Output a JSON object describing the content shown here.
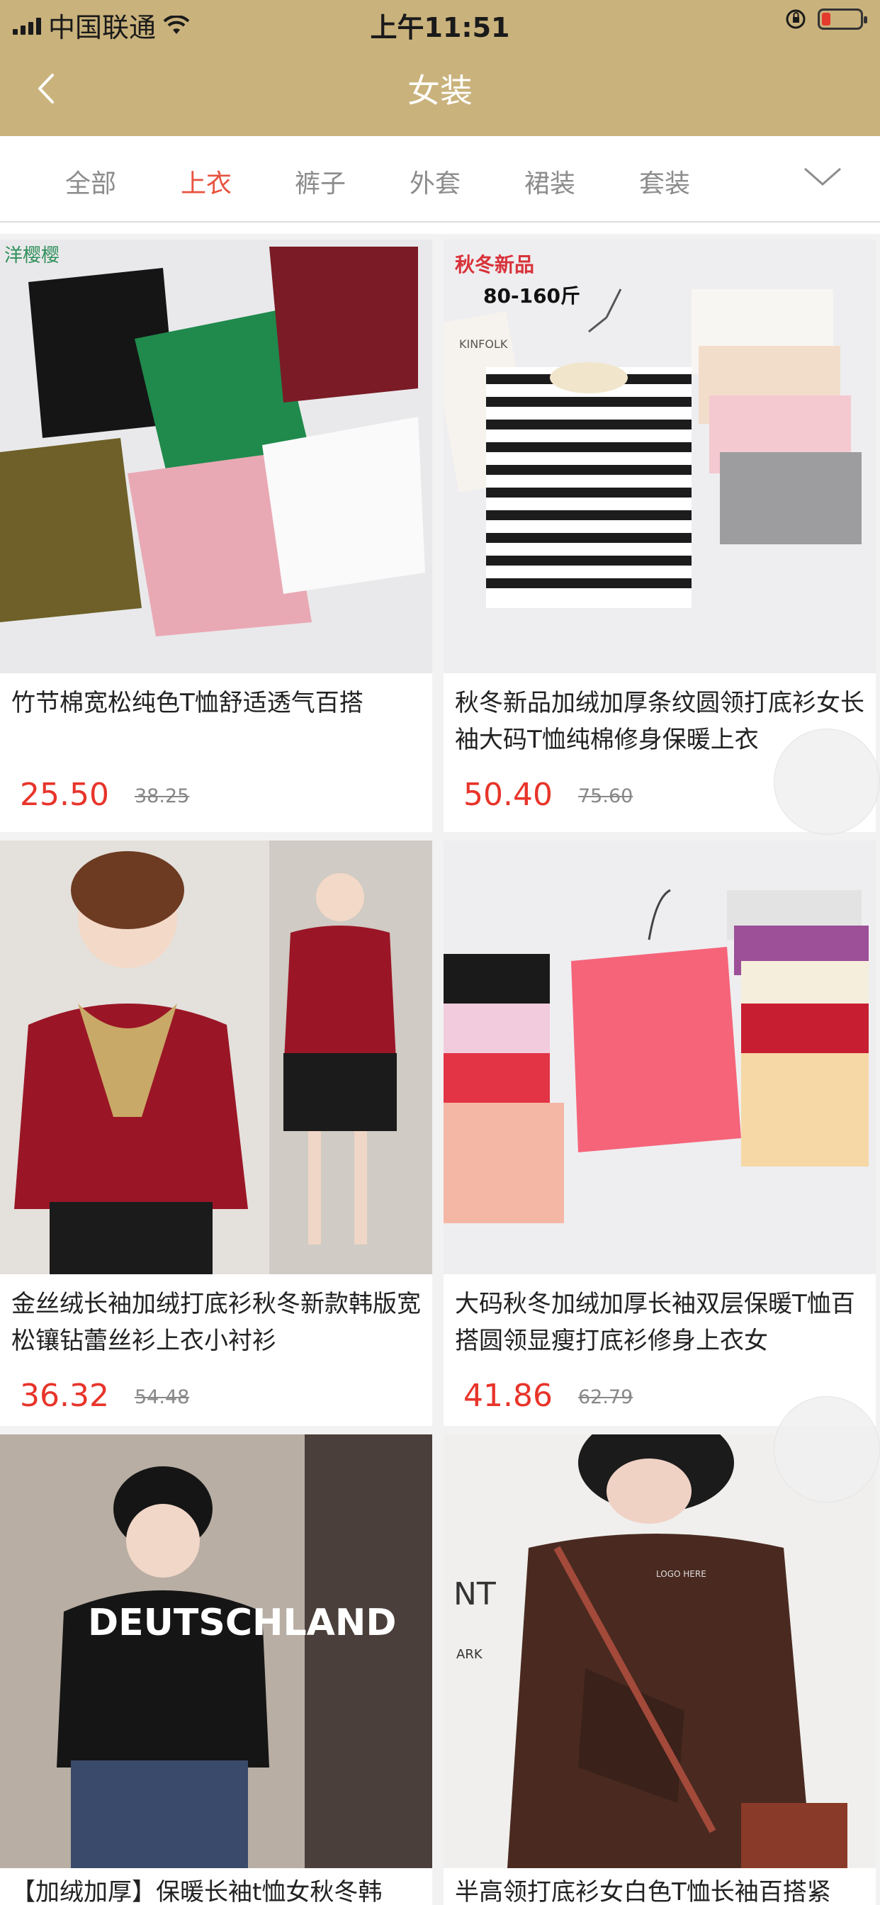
{
  "status": {
    "carrier": "中国联通",
    "time": "上午11:51"
  },
  "header": {
    "title": "女装"
  },
  "tabs": [
    {
      "label": "全部"
    },
    {
      "label": "上衣"
    },
    {
      "label": "裤子"
    },
    {
      "label": "外套"
    },
    {
      "label": "裙装"
    },
    {
      "label": "套装"
    }
  ],
  "colors": {
    "header_bg": "#c9b27c",
    "active_tab": "#e8533f",
    "price": "#e8342a"
  },
  "products": [
    {
      "name": "竹节棉宽松纯色T恤舒适透气百搭",
      "price": "25.50",
      "original_price": "38.25",
      "image_text": [
        "洋樱樱"
      ]
    },
    {
      "name": "秋冬新品加绒加厚条纹圆领打底衫女长袖大码T恤纯棉修身保暖上衣",
      "price": "50.40",
      "original_price": "75.60",
      "image_text": [
        "秋冬新品",
        "80-160斤",
        "KINFOLK"
      ]
    },
    {
      "name": "金丝绒长袖加绒打底衫秋冬新款韩版宽松镶钻蕾丝衫上衣小衬衫",
      "price": "36.32",
      "original_price": "54.48",
      "image_text": []
    },
    {
      "name": "大码秋冬加绒加厚长袖双层保暖T恤百搭圆领显瘦打底衫修身上衣女",
      "price": "41.86",
      "original_price": "62.79",
      "image_text": []
    },
    {
      "name": "【加绒加厚】保暖长袖t恤女秋冬韩",
      "image_text": [
        "DEUTSCHLAND"
      ]
    },
    {
      "name": "半高领打底衫女白色T恤长袖百搭紧",
      "image_text": [
        "NT",
        "ARK",
        "LOGO HERE"
      ]
    }
  ]
}
